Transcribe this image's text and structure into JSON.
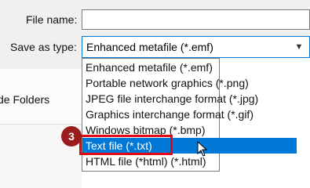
{
  "file_name": {
    "label": "File name:",
    "value": ""
  },
  "save_as_type": {
    "label": "Save as type:",
    "value": "Enhanced metafile (*.emf)"
  },
  "sidebar": {
    "hide_folders_label": "de Folders"
  },
  "dropdown": {
    "options": [
      "Enhanced metafile (*.emf)",
      "Portable network graphics (*.png)",
      "JPEG file interchange format (*.jpg)",
      "Graphics interchange format (*.gif)",
      "Windows bitmap (*.bmp)",
      "Text file (*.txt)",
      "HTML file (*html) (*.html)"
    ],
    "selected_index": 5
  },
  "annotation": {
    "step_number": "3"
  },
  "colors": {
    "selection": "#0078d7",
    "highlight": "#e30613",
    "badge": "#9b1c1c"
  }
}
